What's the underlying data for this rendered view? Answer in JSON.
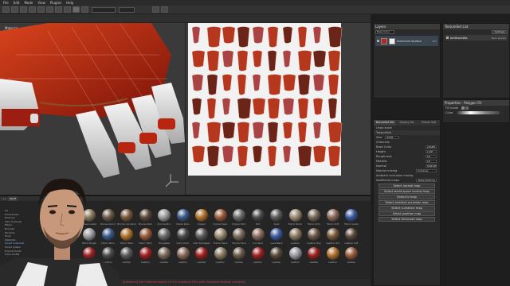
{
  "menu": [
    "File",
    "Edit",
    "Mode",
    "View",
    "Plugins",
    "Help"
  ],
  "viewport3d": {
    "material_label": "Material"
  },
  "layers": {
    "title": "Layers",
    "blend": "Base Color",
    "layer_name": "Aluminium Anodize",
    "layer_opacity": "100"
  },
  "texture_set_list": {
    "title": "TextureSet List",
    "settings": "Settings",
    "item": "ArmBracelets",
    "shader": "Main shader"
  },
  "properties": {
    "title": "Properties - Polygon Fill",
    "fill_mode": "Fill mode",
    "color_label": "Color"
  },
  "texture_set": {
    "tabs": [
      "TextureSet Set",
      "Display Set",
      "Viewer Sett"
    ],
    "undo_stack": "Undo stack",
    "texture_set_label": "TextureSet",
    "size_label": "Size",
    "size_value": "2048",
    "channels_label": "Channels",
    "channels": [
      {
        "name": "Base Color",
        "fmt": "sRGB8"
      },
      {
        "name": "Height",
        "fmt": "L16F"
      },
      {
        "name": "Roughness",
        "fmt": "L8"
      },
      {
        "name": "Metallic",
        "fmt": "L8"
      },
      {
        "name": "Normal",
        "fmt": "RGB16F"
      }
    ],
    "normal_mixing_label": "Normal mixing",
    "normal_mixing_value": "Combine",
    "ao_mixing_label": "Ambient occlusion mixing",
    "additional_maps_label": "Additional maps",
    "bake_textures": "Bake textures",
    "map_buttons": [
      "Select normal map",
      "Select world space normal map",
      "Select id map",
      "Select ambient occlusion map",
      "Select curvature map",
      "Select position map",
      "Select thickness map"
    ]
  },
  "shelf": {
    "tabs": [
      "Log",
      "Shelf"
    ],
    "categories": [
      "All",
      "Procedurals",
      "Textures",
      "Hard Surfaces",
      "Filters",
      "Brushes",
      "Particles",
      "Tools",
      "Materials",
      "Smart materials",
      "Smart masks",
      "Environments",
      "Color profile"
    ],
    "selected_category": "Smart materials",
    "row1": [
      "Brass Coated",
      "Bronze Armor",
      "Bronze Corroded",
      "Bronze Stat.",
      "Chrome Bru.",
      "Cobalt Dam.",
      "Copper",
      "Copper Rest.",
      "Copper Worn",
      "Dirt",
      "Dust",
      "Fabric Bump",
      "Fabric Dirty",
      "Fabric Soft",
      "Fabric Suede"
    ],
    "row2": [
      "Fabric Rough",
      "Fabric Worn",
      "Fabric Wool",
      "Fabric WG3",
      "Fiberglass",
      "Gold Armor",
      "Gold Damaged",
      "Human Back",
      "Human Face",
      "Iron Rust",
      "Lava Black",
      "Leather",
      "Leather Bag",
      "Leather Old",
      "Leather Soft"
    ],
    "row3": [
      "Leather",
      "Leather",
      "Leather",
      "Leather",
      "Leather",
      "Leather",
      "Leather",
      "Leather",
      "Leather",
      "Leather",
      "Leather",
      "Leather",
      "Leather",
      "Leather",
      "Leather"
    ]
  },
  "status": "[Substance] Can't write permission (id 5 or Substance Plain path: Substance textures cannot be)",
  "colors": {
    "accent_red": "#a52a1a",
    "panel": "#2a2a2a",
    "selected": "#4a6a8a"
  }
}
